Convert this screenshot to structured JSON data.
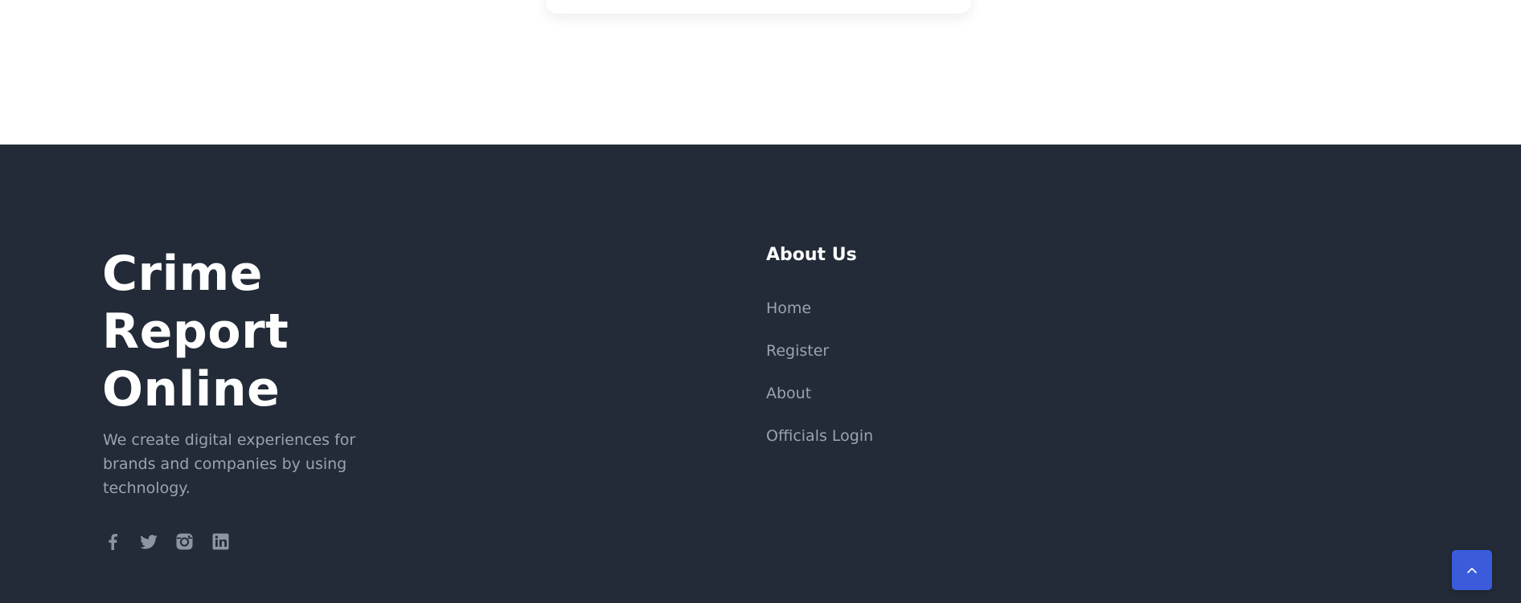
{
  "footer": {
    "brand": {
      "title": "Crime Report Online",
      "description": "We create digital experiences for brands and companies by using technology."
    },
    "social_icons": [
      "facebook-icon",
      "twitter-icon",
      "instagram-icon",
      "linkedin-icon"
    ],
    "about": {
      "heading": "About Us",
      "links": [
        {
          "label": "Home"
        },
        {
          "label": "Register"
        },
        {
          "label": "About"
        },
        {
          "label": "Officials Login"
        }
      ]
    }
  },
  "back_to_top": {
    "icon": "chevron-up-icon"
  },
  "colors": {
    "footer_background": "#222b37",
    "heading_text": "#ffffff",
    "muted_text": "#9aa3af",
    "accent": "#3b5bdb"
  }
}
